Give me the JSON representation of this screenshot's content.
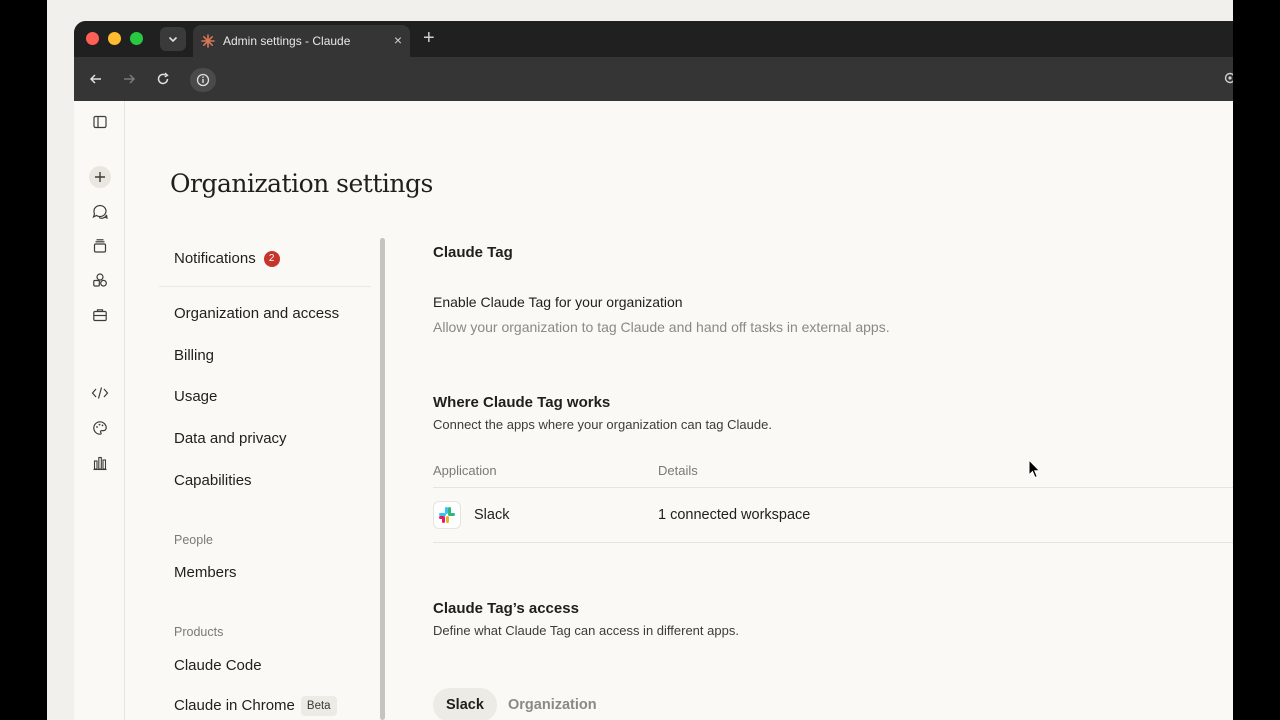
{
  "browser": {
    "tab_title": "Admin settings - Claude",
    "tab_close": "×",
    "new_tab": "+"
  },
  "page": {
    "title": "Organization settings"
  },
  "settings_nav": {
    "notifications": {
      "label": "Notifications",
      "badge": "2"
    },
    "items": [
      "Organization and access",
      "Billing",
      "Usage",
      "Data and privacy",
      "Capabilities"
    ],
    "sections": [
      {
        "title": "People",
        "items": [
          "Members"
        ]
      },
      {
        "title": "Products",
        "items": [
          "Claude Code",
          "Claude in Chrome"
        ]
      }
    ],
    "beta_label": "Beta"
  },
  "main": {
    "section_title": "Claude Tag",
    "enable": {
      "label": "Enable Claude Tag for your organization",
      "description": "Allow your organization to tag Claude and hand off tasks in external apps."
    },
    "where_works": {
      "title": "Where Claude Tag works",
      "description": "Connect the apps where your organization can tag Claude.",
      "columns": [
        "Application",
        "Details"
      ],
      "rows": [
        {
          "app": "Slack",
          "details": "1 connected workspace"
        }
      ]
    },
    "access": {
      "title": "Claude Tag’s access",
      "description": "Define what Claude Tag can access in different apps.",
      "tabs": [
        "Slack",
        "Organization"
      ],
      "active_tab": "Slack"
    }
  },
  "colors": {
    "accent_badge": "#c6352b",
    "claude_orange": "#d97757"
  }
}
